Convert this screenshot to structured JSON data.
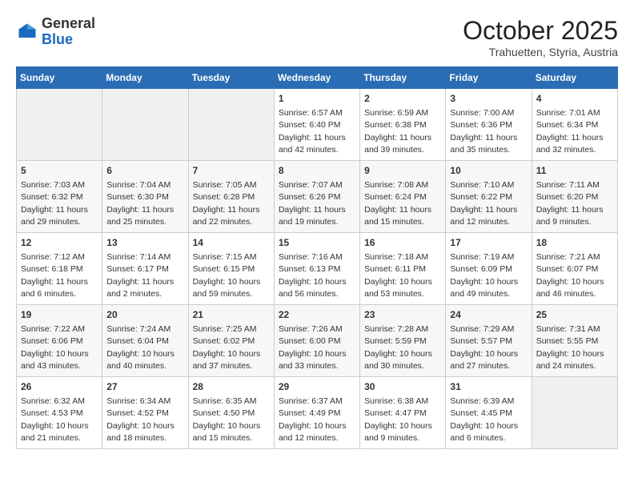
{
  "header": {
    "logo_general": "General",
    "logo_blue": "Blue",
    "month": "October 2025",
    "location": "Trahuetten, Styria, Austria"
  },
  "days_of_week": [
    "Sunday",
    "Monday",
    "Tuesday",
    "Wednesday",
    "Thursday",
    "Friday",
    "Saturday"
  ],
  "weeks": [
    [
      {
        "day": "",
        "info": ""
      },
      {
        "day": "",
        "info": ""
      },
      {
        "day": "",
        "info": ""
      },
      {
        "day": "1",
        "info": "Sunrise: 6:57 AM\nSunset: 6:40 PM\nDaylight: 11 hours and 42 minutes."
      },
      {
        "day": "2",
        "info": "Sunrise: 6:59 AM\nSunset: 6:38 PM\nDaylight: 11 hours and 39 minutes."
      },
      {
        "day": "3",
        "info": "Sunrise: 7:00 AM\nSunset: 6:36 PM\nDaylight: 11 hours and 35 minutes."
      },
      {
        "day": "4",
        "info": "Sunrise: 7:01 AM\nSunset: 6:34 PM\nDaylight: 11 hours and 32 minutes."
      }
    ],
    [
      {
        "day": "5",
        "info": "Sunrise: 7:03 AM\nSunset: 6:32 PM\nDaylight: 11 hours and 29 minutes."
      },
      {
        "day": "6",
        "info": "Sunrise: 7:04 AM\nSunset: 6:30 PM\nDaylight: 11 hours and 25 minutes."
      },
      {
        "day": "7",
        "info": "Sunrise: 7:05 AM\nSunset: 6:28 PM\nDaylight: 11 hours and 22 minutes."
      },
      {
        "day": "8",
        "info": "Sunrise: 7:07 AM\nSunset: 6:26 PM\nDaylight: 11 hours and 19 minutes."
      },
      {
        "day": "9",
        "info": "Sunrise: 7:08 AM\nSunset: 6:24 PM\nDaylight: 11 hours and 15 minutes."
      },
      {
        "day": "10",
        "info": "Sunrise: 7:10 AM\nSunset: 6:22 PM\nDaylight: 11 hours and 12 minutes."
      },
      {
        "day": "11",
        "info": "Sunrise: 7:11 AM\nSunset: 6:20 PM\nDaylight: 11 hours and 9 minutes."
      }
    ],
    [
      {
        "day": "12",
        "info": "Sunrise: 7:12 AM\nSunset: 6:18 PM\nDaylight: 11 hours and 6 minutes."
      },
      {
        "day": "13",
        "info": "Sunrise: 7:14 AM\nSunset: 6:17 PM\nDaylight: 11 hours and 2 minutes."
      },
      {
        "day": "14",
        "info": "Sunrise: 7:15 AM\nSunset: 6:15 PM\nDaylight: 10 hours and 59 minutes."
      },
      {
        "day": "15",
        "info": "Sunrise: 7:16 AM\nSunset: 6:13 PM\nDaylight: 10 hours and 56 minutes."
      },
      {
        "day": "16",
        "info": "Sunrise: 7:18 AM\nSunset: 6:11 PM\nDaylight: 10 hours and 53 minutes."
      },
      {
        "day": "17",
        "info": "Sunrise: 7:19 AM\nSunset: 6:09 PM\nDaylight: 10 hours and 49 minutes."
      },
      {
        "day": "18",
        "info": "Sunrise: 7:21 AM\nSunset: 6:07 PM\nDaylight: 10 hours and 46 minutes."
      }
    ],
    [
      {
        "day": "19",
        "info": "Sunrise: 7:22 AM\nSunset: 6:06 PM\nDaylight: 10 hours and 43 minutes."
      },
      {
        "day": "20",
        "info": "Sunrise: 7:24 AM\nSunset: 6:04 PM\nDaylight: 10 hours and 40 minutes."
      },
      {
        "day": "21",
        "info": "Sunrise: 7:25 AM\nSunset: 6:02 PM\nDaylight: 10 hours and 37 minutes."
      },
      {
        "day": "22",
        "info": "Sunrise: 7:26 AM\nSunset: 6:00 PM\nDaylight: 10 hours and 33 minutes."
      },
      {
        "day": "23",
        "info": "Sunrise: 7:28 AM\nSunset: 5:59 PM\nDaylight: 10 hours and 30 minutes."
      },
      {
        "day": "24",
        "info": "Sunrise: 7:29 AM\nSunset: 5:57 PM\nDaylight: 10 hours and 27 minutes."
      },
      {
        "day": "25",
        "info": "Sunrise: 7:31 AM\nSunset: 5:55 PM\nDaylight: 10 hours and 24 minutes."
      }
    ],
    [
      {
        "day": "26",
        "info": "Sunrise: 6:32 AM\nSunset: 4:53 PM\nDaylight: 10 hours and 21 minutes."
      },
      {
        "day": "27",
        "info": "Sunrise: 6:34 AM\nSunset: 4:52 PM\nDaylight: 10 hours and 18 minutes."
      },
      {
        "day": "28",
        "info": "Sunrise: 6:35 AM\nSunset: 4:50 PM\nDaylight: 10 hours and 15 minutes."
      },
      {
        "day": "29",
        "info": "Sunrise: 6:37 AM\nSunset: 4:49 PM\nDaylight: 10 hours and 12 minutes."
      },
      {
        "day": "30",
        "info": "Sunrise: 6:38 AM\nSunset: 4:47 PM\nDaylight: 10 hours and 9 minutes."
      },
      {
        "day": "31",
        "info": "Sunrise: 6:39 AM\nSunset: 4:45 PM\nDaylight: 10 hours and 6 minutes."
      },
      {
        "day": "",
        "info": ""
      }
    ]
  ]
}
